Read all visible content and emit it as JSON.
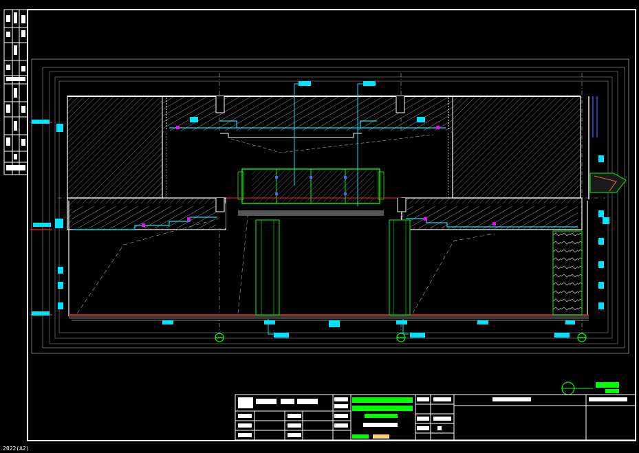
{
  "viewer": {
    "background": "#000000",
    "status_text": "2022(A2)"
  },
  "colors": {
    "frame": "#ffffff",
    "cyan": "#00e5ff",
    "green": "#00ff00",
    "red": "#ff2020",
    "magenta": "#ff00ff",
    "hatch": "#8a8a8a",
    "yellow": "#ffd27a"
  },
  "icons": {
    "grid_bubble": "circle",
    "section_marker": "circled-cross"
  }
}
